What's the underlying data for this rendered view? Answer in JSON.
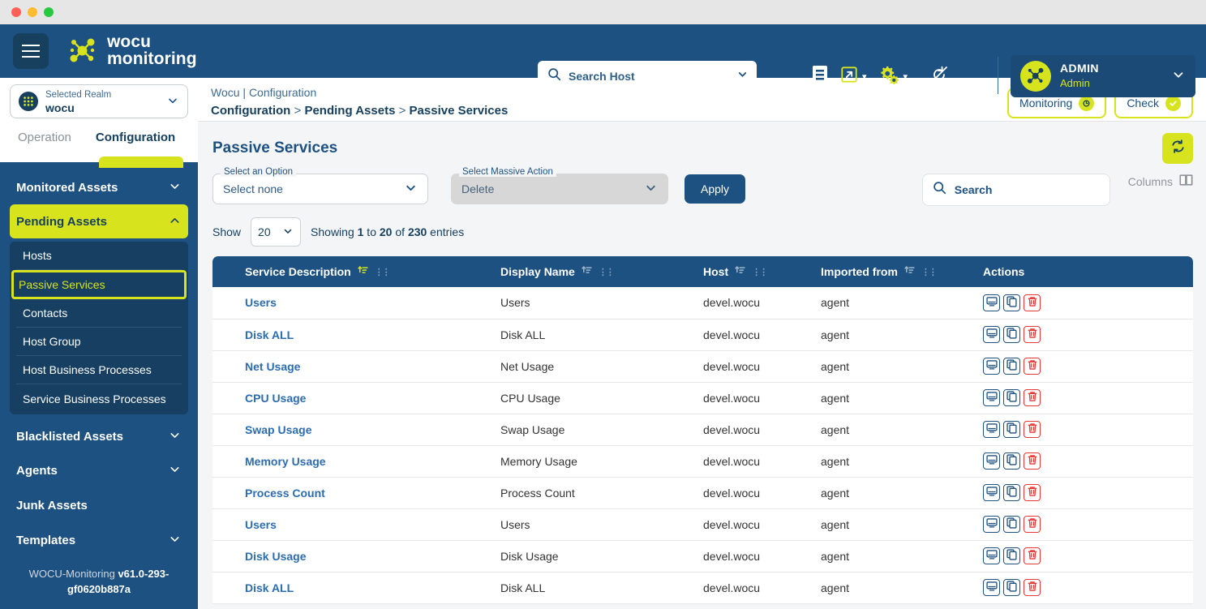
{
  "window": {
    "controls": [
      "close",
      "minimize",
      "maximize"
    ]
  },
  "topbar": {
    "menu_icon": "hamburger-icon",
    "brand_line1": "wocu",
    "brand_line2": "monitoring",
    "host_search": {
      "placeholder": "Search Host",
      "value": "",
      "icon": "search-icon",
      "chevron": "chevron-down-icon"
    },
    "icons": [
      {
        "name": "document-icon",
        "label": "Reports"
      },
      {
        "name": "external-link-icon",
        "label": "Open"
      },
      {
        "name": "gears-icon",
        "label": "Settings"
      },
      {
        "name": "no-refresh-icon",
        "label": "Auto refresh off"
      }
    ],
    "user": {
      "name": "ADMIN",
      "role": "Admin",
      "avatar": "wocu-avatar",
      "chevron": "chevron-down-icon"
    }
  },
  "sidebar": {
    "realm": {
      "label": "Selected Realm",
      "value": "wocu",
      "icon": "realm-icon",
      "chevron": "chevron-down-icon"
    },
    "tabs": [
      {
        "label": "Operation",
        "active": false
      },
      {
        "label": "Configuration",
        "active": true
      }
    ],
    "nav": [
      {
        "label": "Monitored Assets",
        "type": "group",
        "open": false,
        "chevron": "chevron-down-icon"
      },
      {
        "label": "Pending Assets",
        "type": "group",
        "open": true,
        "chevron": "chevron-up-icon"
      },
      {
        "label": "Blacklisted Assets",
        "type": "group",
        "open": false,
        "chevron": "chevron-down-icon"
      },
      {
        "label": "Agents",
        "type": "group",
        "open": false,
        "chevron": "chevron-down-icon"
      },
      {
        "label": "Junk Assets",
        "type": "plain"
      },
      {
        "label": "Templates",
        "type": "group",
        "open": false,
        "chevron": "chevron-down-icon"
      }
    ],
    "pending_assets_items": [
      {
        "label": "Hosts",
        "selected": false
      },
      {
        "label": "Passive Services",
        "selected": true
      },
      {
        "label": "Contacts",
        "selected": false
      },
      {
        "label": "Host Group",
        "selected": false
      },
      {
        "label": "Host Business Processes",
        "selected": false
      },
      {
        "label": "Service Business Processes",
        "selected": false
      }
    ],
    "version_prefix": "WOCU-Monitoring ",
    "version": "v61.0-293-gf0620b887a"
  },
  "breadcrumb": {
    "line1": "Wocu | Configuration",
    "crumb1": "Configuration",
    "sep1": " > ",
    "crumb2": "Pending Assets",
    "sep2": " > ",
    "crumb3": "Passive Services",
    "actions": [
      {
        "label": "Monitoring",
        "icon": "eye-icon"
      },
      {
        "label": "Check",
        "icon": "check-icon"
      }
    ]
  },
  "page": {
    "title": "Passive Services",
    "refresh_icon": "refresh-icon"
  },
  "toolbar": {
    "option_select": {
      "label": "Select an Option",
      "value": "Select none",
      "chevron": "chevron-down-icon"
    },
    "massive_select": {
      "label": "Select Massive Action",
      "value": "Delete",
      "chevron": "chevron-down-icon",
      "disabled": true
    },
    "apply_label": "Apply",
    "search": {
      "placeholder": "Search",
      "value": "",
      "icon": "search-icon"
    },
    "columns_label": "Columns",
    "columns_icon": "columns-icon"
  },
  "pagination": {
    "show_label": "Show",
    "page_size": "20",
    "showing_prefix": "Showing ",
    "from": "1",
    "mid1": " to ",
    "to": "20",
    "mid2": " of ",
    "total": "230",
    "suffix": " entries"
  },
  "table": {
    "columns": [
      {
        "label": "Service Description",
        "sortable": true,
        "sort_active": true,
        "sort_icon": "sort-asc-icon",
        "grip": "grip-icon"
      },
      {
        "label": "Display Name",
        "sortable": true,
        "sort_active": false,
        "sort_icon": "sort-asc-icon",
        "grip": "grip-icon"
      },
      {
        "label": "Host",
        "sortable": true,
        "sort_active": false,
        "sort_icon": "sort-asc-icon",
        "grip": "grip-icon"
      },
      {
        "label": "Imported from",
        "sortable": true,
        "sort_active": false,
        "sort_icon": "sort-asc-icon",
        "grip": "grip-icon"
      },
      {
        "label": "Actions",
        "sortable": false
      }
    ],
    "row_actions": [
      {
        "name": "view-monitor-button",
        "icon": "monitor-icon",
        "style": "primary"
      },
      {
        "name": "duplicate-button",
        "icon": "copy-icon",
        "style": "primary"
      },
      {
        "name": "delete-button",
        "icon": "trash-icon",
        "style": "danger"
      }
    ],
    "rows": [
      {
        "service_description": "Users",
        "display_name": "Users",
        "host": "devel.wocu",
        "imported_from": "agent"
      },
      {
        "service_description": "Disk ALL",
        "display_name": "Disk ALL",
        "host": "devel.wocu",
        "imported_from": "agent"
      },
      {
        "service_description": "Net Usage",
        "display_name": "Net Usage",
        "host": "devel.wocu",
        "imported_from": "agent"
      },
      {
        "service_description": "CPU Usage",
        "display_name": "CPU Usage",
        "host": "devel.wocu",
        "imported_from": "agent"
      },
      {
        "service_description": "Swap Usage",
        "display_name": "Swap Usage",
        "host": "devel.wocu",
        "imported_from": "agent"
      },
      {
        "service_description": "Memory Usage",
        "display_name": "Memory Usage",
        "host": "devel.wocu",
        "imported_from": "agent"
      },
      {
        "service_description": "Process Count",
        "display_name": "Process Count",
        "host": "devel.wocu",
        "imported_from": "agent"
      },
      {
        "service_description": "Users",
        "display_name": "Users",
        "host": "devel.wocu",
        "imported_from": "agent"
      },
      {
        "service_description": "Disk Usage",
        "display_name": "Disk Usage",
        "host": "devel.wocu",
        "imported_from": "agent"
      },
      {
        "service_description": "Disk ALL",
        "display_name": "Disk ALL",
        "host": "devel.wocu",
        "imported_from": "agent"
      }
    ]
  },
  "colors": {
    "brand_blue": "#1d5181",
    "brand_dark": "#17405f",
    "accent_yellow": "#d7e31d",
    "link_blue": "#2c6cb0",
    "danger_red": "#e53935",
    "page_bg": "#f4f5f7"
  }
}
